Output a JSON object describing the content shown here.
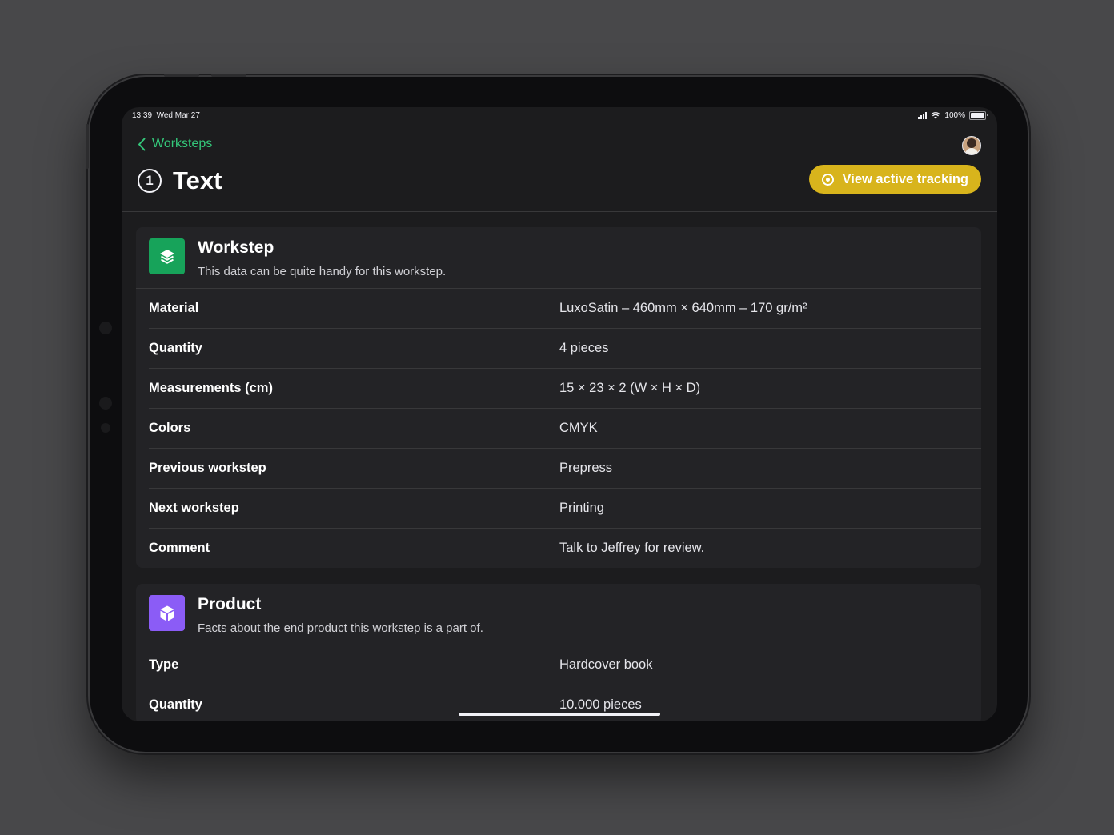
{
  "status_bar": {
    "time": "13:39",
    "date": "Wed Mar 27",
    "battery": "100%"
  },
  "nav": {
    "back_label": "Worksteps",
    "title": "Text",
    "step_number": "1",
    "track_button": "View active tracking"
  },
  "colors": {
    "accent_green": "#34c77a",
    "track_yellow": "#d8b41c",
    "workstep_icon": "#17a35a",
    "product_icon": "#8b5cf6"
  },
  "icons": {
    "back": "chevron-left-icon",
    "workstep": "layers-icon",
    "product": "cube-icon",
    "track": "target-icon"
  },
  "workstep": {
    "title": "Workstep",
    "subtitle": "This data can be quite handy for this workstep.",
    "rows": [
      {
        "label": "Material",
        "value": "LuxoSatin – 460mm × 640mm – 170 gr/m²"
      },
      {
        "label": "Quantity",
        "value": "4 pieces"
      },
      {
        "label": "Measurements (cm)",
        "value": "15 × 23 × 2 (W × H × D)"
      },
      {
        "label": "Colors",
        "value": "CMYK"
      },
      {
        "label": "Previous workstep",
        "value": "Prepress"
      },
      {
        "label": "Next workstep",
        "value": "Printing"
      },
      {
        "label": "Comment",
        "value": "Talk to Jeffrey for review."
      }
    ]
  },
  "product": {
    "title": "Product",
    "subtitle": "Facts about the end product this workstep is a part of.",
    "rows": [
      {
        "label": "Type",
        "value": "Hardcover book"
      },
      {
        "label": "Quantity",
        "value": "10.000 pieces"
      }
    ]
  }
}
